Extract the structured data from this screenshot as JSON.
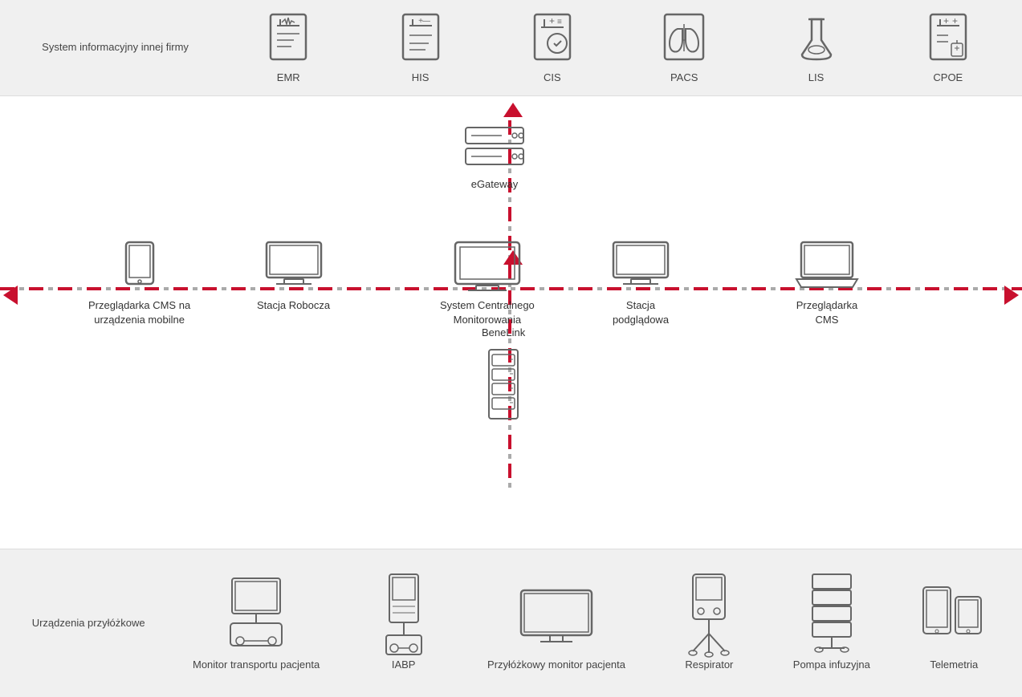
{
  "top_band": {
    "system_info_label": "System\ninformacyjny\ninnej firmy",
    "items": [
      {
        "id": "emr",
        "label": "EMR"
      },
      {
        "id": "his",
        "label": "HIS"
      },
      {
        "id": "cis",
        "label": "CIS"
      },
      {
        "id": "pacs",
        "label": "PACS"
      },
      {
        "id": "lis",
        "label": "LIS"
      },
      {
        "id": "cpoe",
        "label": "CPOE"
      }
    ]
  },
  "bottom_band": {
    "section_label": "Urządzenia\nprzyłóżkowe",
    "items": [
      {
        "id": "monitor-transport",
        "label": "Monitor\ntransportu\npacjenta"
      },
      {
        "id": "iabp",
        "label": "IABP"
      },
      {
        "id": "przylozkowy-monitor",
        "label": "Przyłóżkowy\nmonitor\npacjenta"
      },
      {
        "id": "respirator",
        "label": "Respirator"
      },
      {
        "id": "pompa-infuzyjna",
        "label": "Pompa\ninfuzyjna"
      },
      {
        "id": "telemetria",
        "label": "Telemetria"
      }
    ]
  },
  "main_nodes": {
    "egateway": {
      "label": "eGateway"
    },
    "cms": {
      "label": "System Centralnego\nMonitorowania"
    },
    "benelink": {
      "label": "BeneLink"
    },
    "stacja_robocza": {
      "label": "Stacja Robocza"
    },
    "przegladarka_mobile": {
      "label": "Przeglądarka CMS na\nurządzenia mobilne"
    },
    "stacja_podgladowa": {
      "label": "Stacja\npodglądowa"
    },
    "przegladarka_cms": {
      "label": "Przeglądarka\nCMS"
    }
  },
  "colors": {
    "red": "#c8102e",
    "gray": "#888",
    "band_bg": "#f0f0f0",
    "icon_stroke": "#666"
  }
}
